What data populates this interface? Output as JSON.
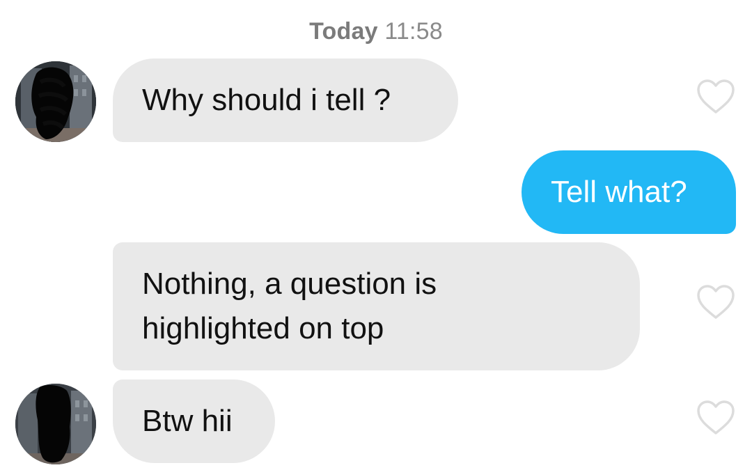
{
  "header": {
    "timestamp_day": "Today",
    "timestamp_time": "11:58"
  },
  "messages": [
    {
      "sender": "them",
      "text": "Why should i tell ?",
      "has_avatar": true,
      "liked": false
    },
    {
      "sender": "me",
      "text": "Tell what?"
    },
    {
      "sender": "them",
      "text_lines": [
        "Nothing, a question is",
        "highlighted on top"
      ],
      "has_avatar": false,
      "liked": false
    },
    {
      "sender": "them",
      "text": "Btw hii",
      "has_avatar": true,
      "liked": false
    }
  ],
  "colors": {
    "incoming_bubble": "#e9e9e9",
    "outgoing_bubble": "#22b8f5",
    "timestamp_text": "#888888",
    "heart_outline": "#dcdcdc"
  },
  "icons": {
    "like": "heart-outline-icon",
    "avatar": "contact-avatar-redacted"
  }
}
